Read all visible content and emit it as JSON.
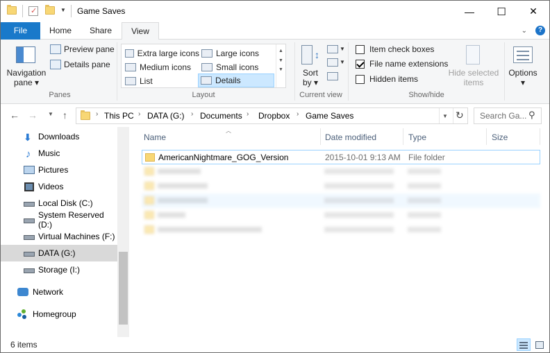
{
  "window": {
    "title": "Game Saves",
    "controls": {
      "minimize": "—",
      "maximize": "☐",
      "close": "✕"
    }
  },
  "ribbon_tabs": [
    {
      "label": "File"
    },
    {
      "label": "Home"
    },
    {
      "label": "Share"
    },
    {
      "label": "View"
    }
  ],
  "ribbon": {
    "panes": {
      "group_label": "Panes",
      "navigation_pane": "Navigation\npane ▾",
      "preview_pane": "Preview pane",
      "details_pane": "Details pane"
    },
    "layout": {
      "group_label": "Layout",
      "extra_large_icons": "Extra large icons",
      "large_icons": "Large icons",
      "medium_icons": "Medium icons",
      "small_icons": "Small icons",
      "list": "List",
      "details": "Details"
    },
    "current_view": {
      "group_label": "Current view",
      "sort_by": "Sort\nby ▾"
    },
    "show_hide": {
      "group_label": "Show/hide",
      "item_check_boxes": "Item check boxes",
      "file_name_extensions": "File name extensions",
      "hidden_items": "Hidden items",
      "item_check_boxes_checked": false,
      "file_name_extensions_checked": true,
      "hidden_items_checked": false,
      "hide_selected_items": "Hide selected\nitems"
    },
    "options": {
      "label": "Options\n▾"
    }
  },
  "address": {
    "crumbs": [
      "This PC",
      "DATA (G:)",
      "Documents",
      "Dropbox",
      "Game Saves"
    ],
    "search_placeholder": "Search Ga..."
  },
  "nav_pane": [
    {
      "label": "Downloads",
      "icon": "downloads-icon"
    },
    {
      "label": "Music",
      "icon": "music-icon"
    },
    {
      "label": "Pictures",
      "icon": "pictures-icon"
    },
    {
      "label": "Videos",
      "icon": "videos-icon"
    },
    {
      "label": "Local Disk (C:)",
      "icon": "drive-icon"
    },
    {
      "label": "System Reserved (D:)",
      "icon": "drive-icon"
    },
    {
      "label": "Virtual Machines (F:)",
      "icon": "drive-icon"
    },
    {
      "label": "DATA (G:)",
      "icon": "drive-icon",
      "selected": true
    },
    {
      "label": "Storage (I:)",
      "icon": "drive-icon"
    },
    {
      "label": "Network",
      "icon": "network-icon"
    },
    {
      "label": "Homegroup",
      "icon": "homegroup-icon"
    }
  ],
  "columns": {
    "name": "Name",
    "date_modified": "Date modified",
    "type": "Type",
    "size": "Size"
  },
  "files": [
    {
      "name": "AmericanNightmare_GOG_Version",
      "date": "2015-10-01 9:13 AM",
      "type": "File folder"
    }
  ],
  "status": {
    "item_count": "6 items"
  },
  "colors": {
    "accent": "#1979ca",
    "selection": "#cce8ff",
    "selection_border": "#99d1ff",
    "folder": "#f8d775"
  }
}
